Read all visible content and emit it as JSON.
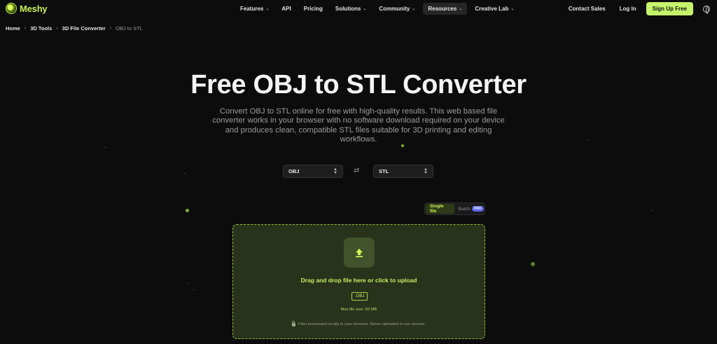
{
  "brand": {
    "name": "Meshy",
    "accent": "#c6f46a"
  },
  "nav": {
    "items": [
      {
        "label": "Features",
        "dropdown": true
      },
      {
        "label": "API",
        "dropdown": false
      },
      {
        "label": "Pricing",
        "dropdown": false
      },
      {
        "label": "Solutions",
        "dropdown": true
      },
      {
        "label": "Community",
        "dropdown": true
      },
      {
        "label": "Resources",
        "dropdown": true,
        "active": true
      },
      {
        "label": "Creative Lab",
        "dropdown": true
      }
    ],
    "contact": "Contact Sales",
    "login": "Log In",
    "signup": "Sign Up Free",
    "language_icon": "globe-icon"
  },
  "breadcrumb": {
    "home": "Home",
    "tools": "3D Tools",
    "converter": "3D File Converter",
    "current": "OBJ to STL"
  },
  "hero": {
    "title": "Free OBJ to STL Converter",
    "description": "Convert OBJ to STL online for free with high-quality results. This web based file converter works in your browser with no software download required on your device and produces clean, compatible STL files suitable for 3D printing and editing workflows."
  },
  "converter": {
    "from_format": "OBJ",
    "to_format": "STL",
    "swap_icon": "swap-arrows-icon",
    "mode_single": "Single file",
    "mode_batch": "Batch",
    "pro_badge": "PRO",
    "upload_icon": "upload-arrow-icon",
    "drop_text": "Drag and drop file here or click to upload",
    "accepted_ext": ".OBJ",
    "max_size": "Max file size: 50 MB",
    "privacy_note": "Files processed locally in your browser. Never uploaded to our servers."
  }
}
